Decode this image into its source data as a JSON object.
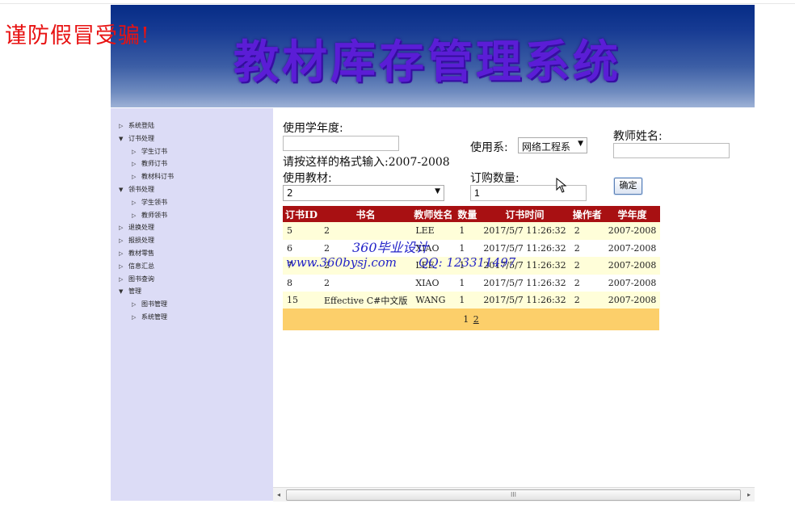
{
  "warning": "谨防假冒受骗!",
  "banner": {
    "title": "教材库存管理系统"
  },
  "tree": [
    {
      "label": "系统登陆",
      "level": 1,
      "expanded": false
    },
    {
      "label": "订书处理",
      "level": 1,
      "expanded": true
    },
    {
      "label": "学生订书",
      "level": 2,
      "expanded": false
    },
    {
      "label": "教师订书",
      "level": 2,
      "expanded": false
    },
    {
      "label": "教材科订书",
      "level": 2,
      "expanded": false
    },
    {
      "label": "领书处理",
      "level": 1,
      "expanded": true
    },
    {
      "label": "学生领书",
      "level": 2,
      "expanded": false
    },
    {
      "label": "教师领书",
      "level": 2,
      "expanded": false
    },
    {
      "label": "退换处理",
      "level": 1,
      "expanded": false
    },
    {
      "label": "报损处理",
      "level": 1,
      "expanded": false
    },
    {
      "label": "教材零售",
      "level": 1,
      "expanded": false
    },
    {
      "label": "信息汇总",
      "level": 1,
      "expanded": false
    },
    {
      "label": "图书查询",
      "level": 1,
      "expanded": false
    },
    {
      "label": "管理",
      "level": 1,
      "expanded": true
    },
    {
      "label": "图书管理",
      "level": 2,
      "expanded": false
    },
    {
      "label": "系统管理",
      "level": 2,
      "expanded": false
    }
  ],
  "form": {
    "year_label": "使用学年度:",
    "year_value": "",
    "format_hint": "请按这样的格式输入:2007-2008",
    "dept_label": "使用系:",
    "dept_value": "网络工程系",
    "teacher_label": "教师姓名:",
    "teacher_value": "",
    "book_label": "使用教材:",
    "book_value": "2",
    "qty_label": "订购数量:",
    "qty_value": "1",
    "ok_label": "确定"
  },
  "table": {
    "headers": [
      "订书ID",
      "书名",
      "教师姓名",
      "数量",
      "订书时间",
      "操作者",
      "学年度"
    ],
    "rows": [
      [
        "5",
        "2",
        "LEE",
        "1",
        "2017/5/7 11:26:32",
        "2",
        "2007-2008"
      ],
      [
        "6",
        "2",
        "XIAO",
        "1",
        "2017/5/7 11:26:32",
        "2",
        "2007-2008"
      ],
      [
        "7",
        "2",
        "LEE",
        "1",
        "2017/5/7 11:26:32",
        "2",
        "2007-2008"
      ],
      [
        "8",
        "2",
        "XIAO",
        "1",
        "2017/5/7 11:26:32",
        "2",
        "2007-2008"
      ],
      [
        "15",
        "Effective C#中文版",
        "WANG",
        "1",
        "2017/5/7 11:26:32",
        "2",
        "2007-2008"
      ]
    ]
  },
  "pager": {
    "current": "1",
    "next": "2"
  },
  "watermark": {
    "line1": "360毕业设计",
    "site": "www.360bysj.com",
    "qq": "QQ:   123311497"
  },
  "scrollbar": {
    "thumb_grip": "III",
    "left_arrow": "◂",
    "right_arrow": "▸"
  },
  "icons": {
    "collapsed": "▷",
    "expanded": "▼",
    "dropdown": "▼"
  },
  "colors": {
    "header_bg": "#a81012",
    "pager_bg": "#fccf6a",
    "odd_row": "#fffed9",
    "sidebar_bg": "#dcdcf6"
  }
}
